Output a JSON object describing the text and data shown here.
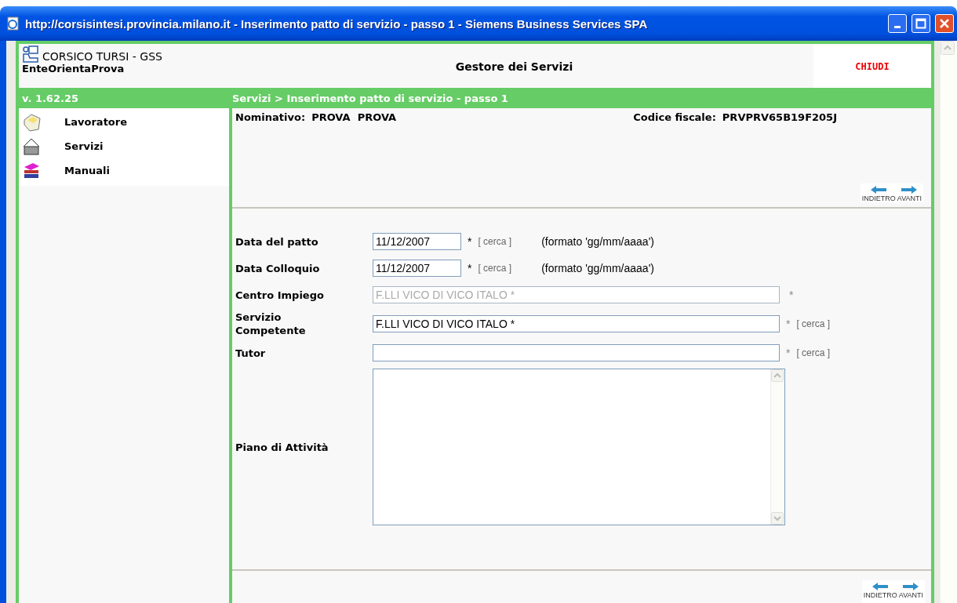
{
  "window": {
    "title": "http://corsisintesi.provincia.milano.it - Inserimento patto di servizio - passo 1 - Siemens Business Services SPA"
  },
  "header": {
    "org": "CORSICO TURSI - GSS",
    "ente": "EnteOrientaProva",
    "app_title": "Gestore dei Servizi",
    "close_label": "CHIUDI"
  },
  "green_bar": {
    "version": "v. 1.62.25",
    "breadcrumb": "Servizi > Inserimento patto di servizio - passo 1"
  },
  "sidebar": {
    "items": [
      {
        "label": "Lavoratore",
        "kind": "folder"
      },
      {
        "label": "Servizi",
        "kind": "basket"
      },
      {
        "label": "Manuali",
        "kind": "books"
      }
    ]
  },
  "info": {
    "nominativo_label": "Nominativo:",
    "nominativo_value": "PROVA  PROVA",
    "codice_label": "Codice fiscale:",
    "codice_value": "PRVPRV65B19F205J"
  },
  "nav_top": {
    "back": "INDIETRO",
    "forward": "AVANTI"
  },
  "form": {
    "fields": [
      {
        "label": "Data del patto",
        "kind": "date",
        "value": "11/12/2007",
        "disabled": false,
        "required": "*",
        "search": "[ cerca ]",
        "hint": "(formato 'gg/mm/aaaa')"
      },
      {
        "label": "Data Colloquio",
        "kind": "date",
        "value": "11/12/2007",
        "disabled": false,
        "required": "*",
        "search": "[ cerca ]",
        "hint": "(formato 'gg/mm/aaaa')"
      },
      {
        "label": "Centro Impiego",
        "kind": "text",
        "value": "F.LLI VICO DI VICO ITALO *",
        "disabled": true,
        "required": "*"
      },
      {
        "label": "Servizio Competente",
        "kind": "text",
        "value": "F.LLI VICO DI VICO ITALO *",
        "disabled": false,
        "required": "*",
        "search": "[ cerca ]"
      },
      {
        "label": "Tutor",
        "kind": "text",
        "disabled": false,
        "required": "*",
        "search": "[ cerca ]"
      },
      {
        "label": "Piano di Attività",
        "kind": "textarea",
        "disabled": false
      }
    ]
  },
  "nav_bottom": {
    "back": "INDIETRO",
    "forward": "AVANTI"
  }
}
